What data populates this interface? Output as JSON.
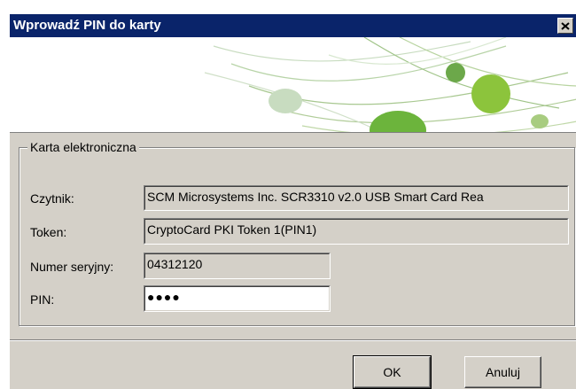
{
  "window": {
    "title": "Wprowadź PIN do karty"
  },
  "icons": {
    "close": "close-icon",
    "banner": "green-swoosh-banner"
  },
  "colors": {
    "titlebar": "#0a246a",
    "face": "#d4d0c8",
    "accent_green": "#8cc43c"
  },
  "group": {
    "legend": "Karta elektroniczna",
    "fields": {
      "reader_label": "Czytnik:",
      "reader_value": "SCM Microsystems Inc. SCR3310 v2.0 USB Smart Card Rea",
      "token_label": "Token:",
      "token_value": "CryptoCard PKI Token 1(PIN1)",
      "serial_label": "Numer seryjny:",
      "serial_value": "04312120",
      "pin_label": "PIN:",
      "pin_value": "●●●●"
    }
  },
  "buttons": {
    "ok": "OK",
    "cancel": "Anuluj"
  }
}
